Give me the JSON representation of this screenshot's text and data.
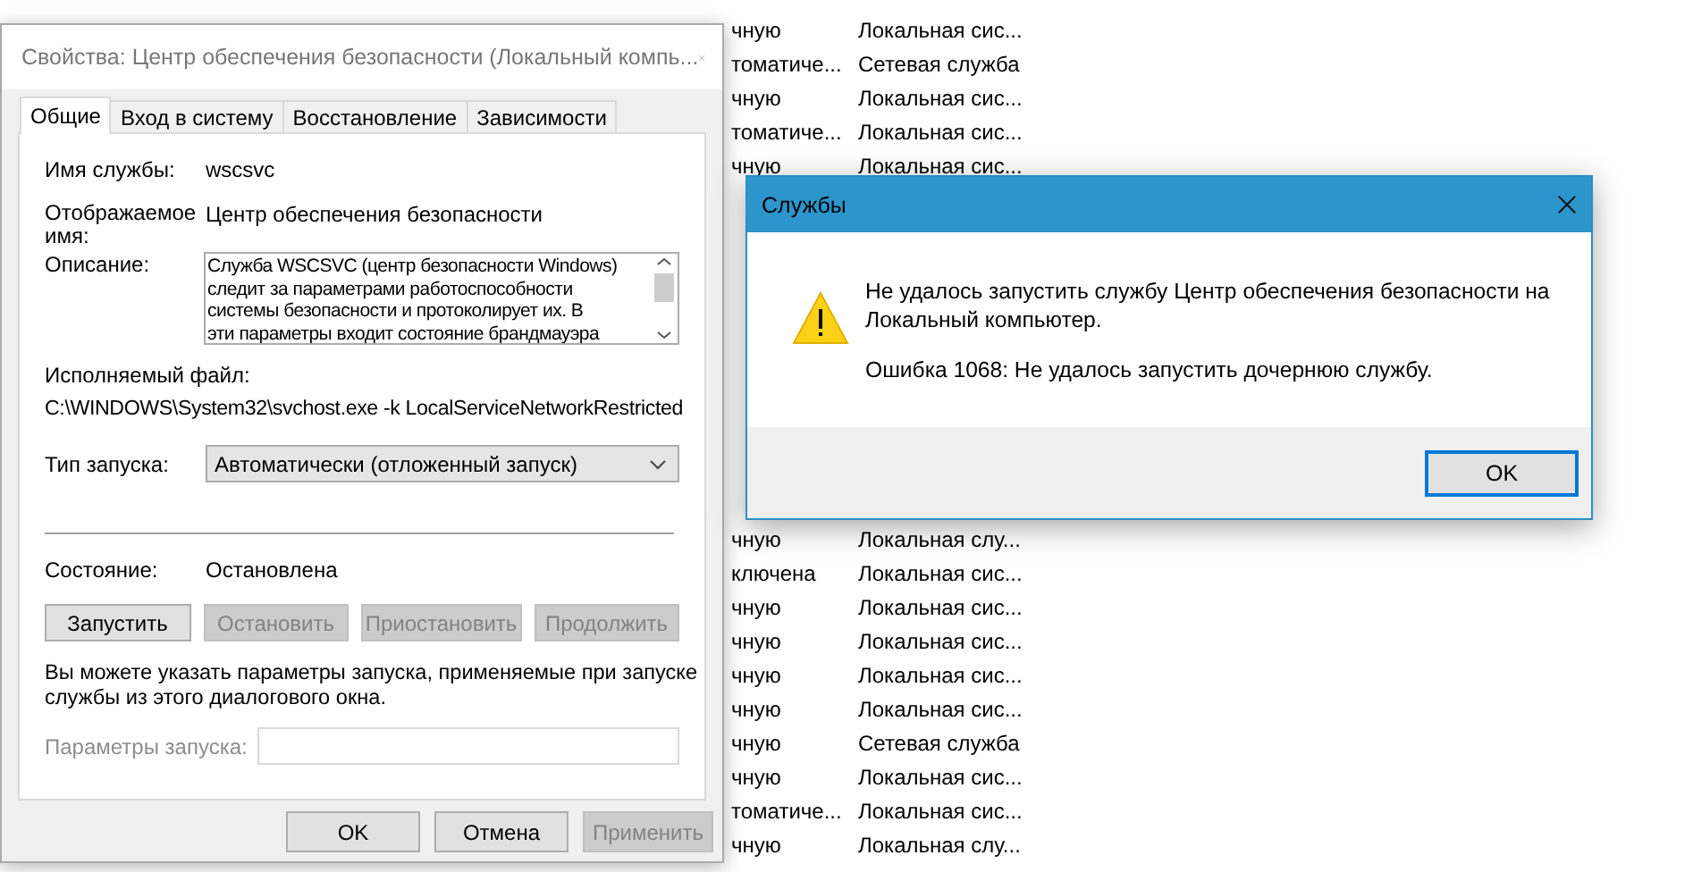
{
  "services_list": {
    "rows": [
      {
        "startup": "чную",
        "log_on": "Локальная сис..."
      },
      {
        "startup": "томатиче...",
        "log_on": "Сетевая служба"
      },
      {
        "startup": "чную",
        "log_on": "Локальная сис..."
      },
      {
        "startup": "томатиче...",
        "log_on": "Локальная сис..."
      },
      {
        "startup": "чную",
        "log_on": "Локальная сис..."
      },
      {},
      {},
      {},
      {},
      {},
      {},
      {},
      {},
      {},
      {},
      {
        "startup": "чную",
        "log_on": "Локальная слу..."
      },
      {
        "startup": "ключена",
        "log_on": "Локальная сис..."
      },
      {
        "startup": "чную",
        "log_on": "Локальная сис..."
      },
      {
        "startup": "чную",
        "log_on": "Локальная сис..."
      },
      {
        "startup": "чную",
        "log_on": "Локальная сис..."
      },
      {
        "startup": "чную",
        "log_on": "Локальная сис..."
      },
      {
        "startup": "чную",
        "log_on": "Сетевая служба"
      },
      {
        "startup": "чную",
        "log_on": "Локальная сис..."
      },
      {
        "startup": "томатиче...",
        "log_on": "Локальная сис..."
      },
      {
        "startup": "чную",
        "log_on": "Локальная слу..."
      }
    ]
  },
  "properties_dialog": {
    "title": "Свойства: Центр обеспечения безопасности (Локальный компь...",
    "tabs": [
      {
        "label": "Общие",
        "selected": true
      },
      {
        "label": "Вход в систему",
        "selected": false
      },
      {
        "label": "Восстановление",
        "selected": false
      },
      {
        "label": "Зависимости",
        "selected": false
      }
    ],
    "service_name": {
      "label": "Имя службы:",
      "value": "wscsvc"
    },
    "display_name": {
      "label": "Отображаемое имя:",
      "value": "Центр обеспечения безопасности"
    },
    "description": {
      "label": "Описание:",
      "lines": [
        "Служба WSCSVC (центр безопасности Windows)",
        "следит за параметрами работоспособности",
        "системы безопасности и протоколирует их. В",
        "эти параметры входит состояние брандмауэра"
      ]
    },
    "executable": {
      "label": "Исполняемый файл:",
      "value": "C:\\WINDOWS\\System32\\svchost.exe -k LocalServiceNetworkRestricted"
    },
    "startup_type": {
      "label": "Тип запуска:",
      "value": "Автоматически (отложенный запуск)"
    },
    "status": {
      "label": "Состояние:",
      "value": "Остановлена"
    },
    "service_buttons": [
      {
        "label": "Запустить",
        "disabled": false
      },
      {
        "label": "Остановить",
        "disabled": true
      },
      {
        "label": "Приостановить",
        "disabled": true
      },
      {
        "label": "Продолжить",
        "disabled": true
      }
    ],
    "hint": "Вы можете указать параметры запуска, применяемые при запуске службы из этого диалогового окна.",
    "start_params": {
      "label": "Параметры запуска:",
      "disabled": true
    },
    "buttons": [
      {
        "label": "OK",
        "disabled": false
      },
      {
        "label": "Отмена",
        "disabled": false
      },
      {
        "label": "Применить",
        "disabled": true
      }
    ]
  },
  "error_dialog": {
    "title": "Службы",
    "message": "Не удалось запустить службу Центр обеспечения безопасности на Локальный компьютер.",
    "error": "Ошибка 1068: Не удалось запустить дочернюю службу.",
    "button": "OK"
  }
}
